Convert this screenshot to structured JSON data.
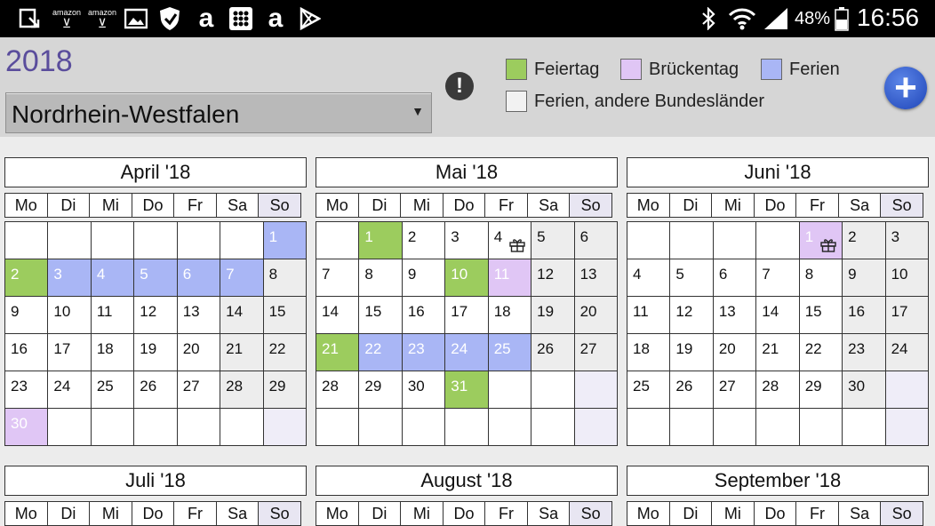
{
  "status_bar": {
    "battery": "48%",
    "time": "16:56",
    "icons_left": [
      "download-icon",
      "amazon-cart-icon",
      "amazon-cart-icon",
      "gallery-icon",
      "shield-icon",
      "amazon-a-icon",
      "calculator-icon",
      "amazon-a-icon",
      "play-store-icon"
    ],
    "amazon_label": "amazon",
    "amazon_letter": "a"
  },
  "header": {
    "year": "2018",
    "state_select": {
      "value": "Nordrhein-Westfalen"
    },
    "info_symbol": "!",
    "add_symbol": "+"
  },
  "legend": {
    "feiertag": {
      "label": "Feiertag",
      "color": "#9ccc5e"
    },
    "brueckentag": {
      "label": "Brückentag",
      "color": "#e0c6f5"
    },
    "ferien": {
      "label": "Ferien",
      "color": "#a9b6f5"
    },
    "ferien_andere": {
      "label": "Ferien, andere Bundesländer",
      "color": "#f2f2f2"
    }
  },
  "weekdays": [
    "Mo",
    "Di",
    "Mi",
    "Do",
    "Fr",
    "Sa",
    "So"
  ],
  "months": [
    {
      "title": "April '18",
      "offset": 6,
      "days": 30,
      "feiertag": [
        2
      ],
      "ferien": [
        1,
        3,
        4,
        5,
        6,
        7
      ],
      "brueckentag": [
        30
      ],
      "gift": []
    },
    {
      "title": "Mai '18",
      "offset": 1,
      "days": 31,
      "feiertag": [
        1,
        10,
        21,
        31
      ],
      "ferien": [
        22,
        23,
        24,
        25
      ],
      "brueckentag": [
        11
      ],
      "gift": [
        4
      ]
    },
    {
      "title": "Juni '18",
      "offset": 4,
      "days": 30,
      "feiertag": [],
      "ferien": [],
      "brueckentag": [
        1
      ],
      "gift": [
        1
      ]
    },
    {
      "title": "Juli '18"
    },
    {
      "title": "August '18"
    },
    {
      "title": "September '18"
    }
  ]
}
